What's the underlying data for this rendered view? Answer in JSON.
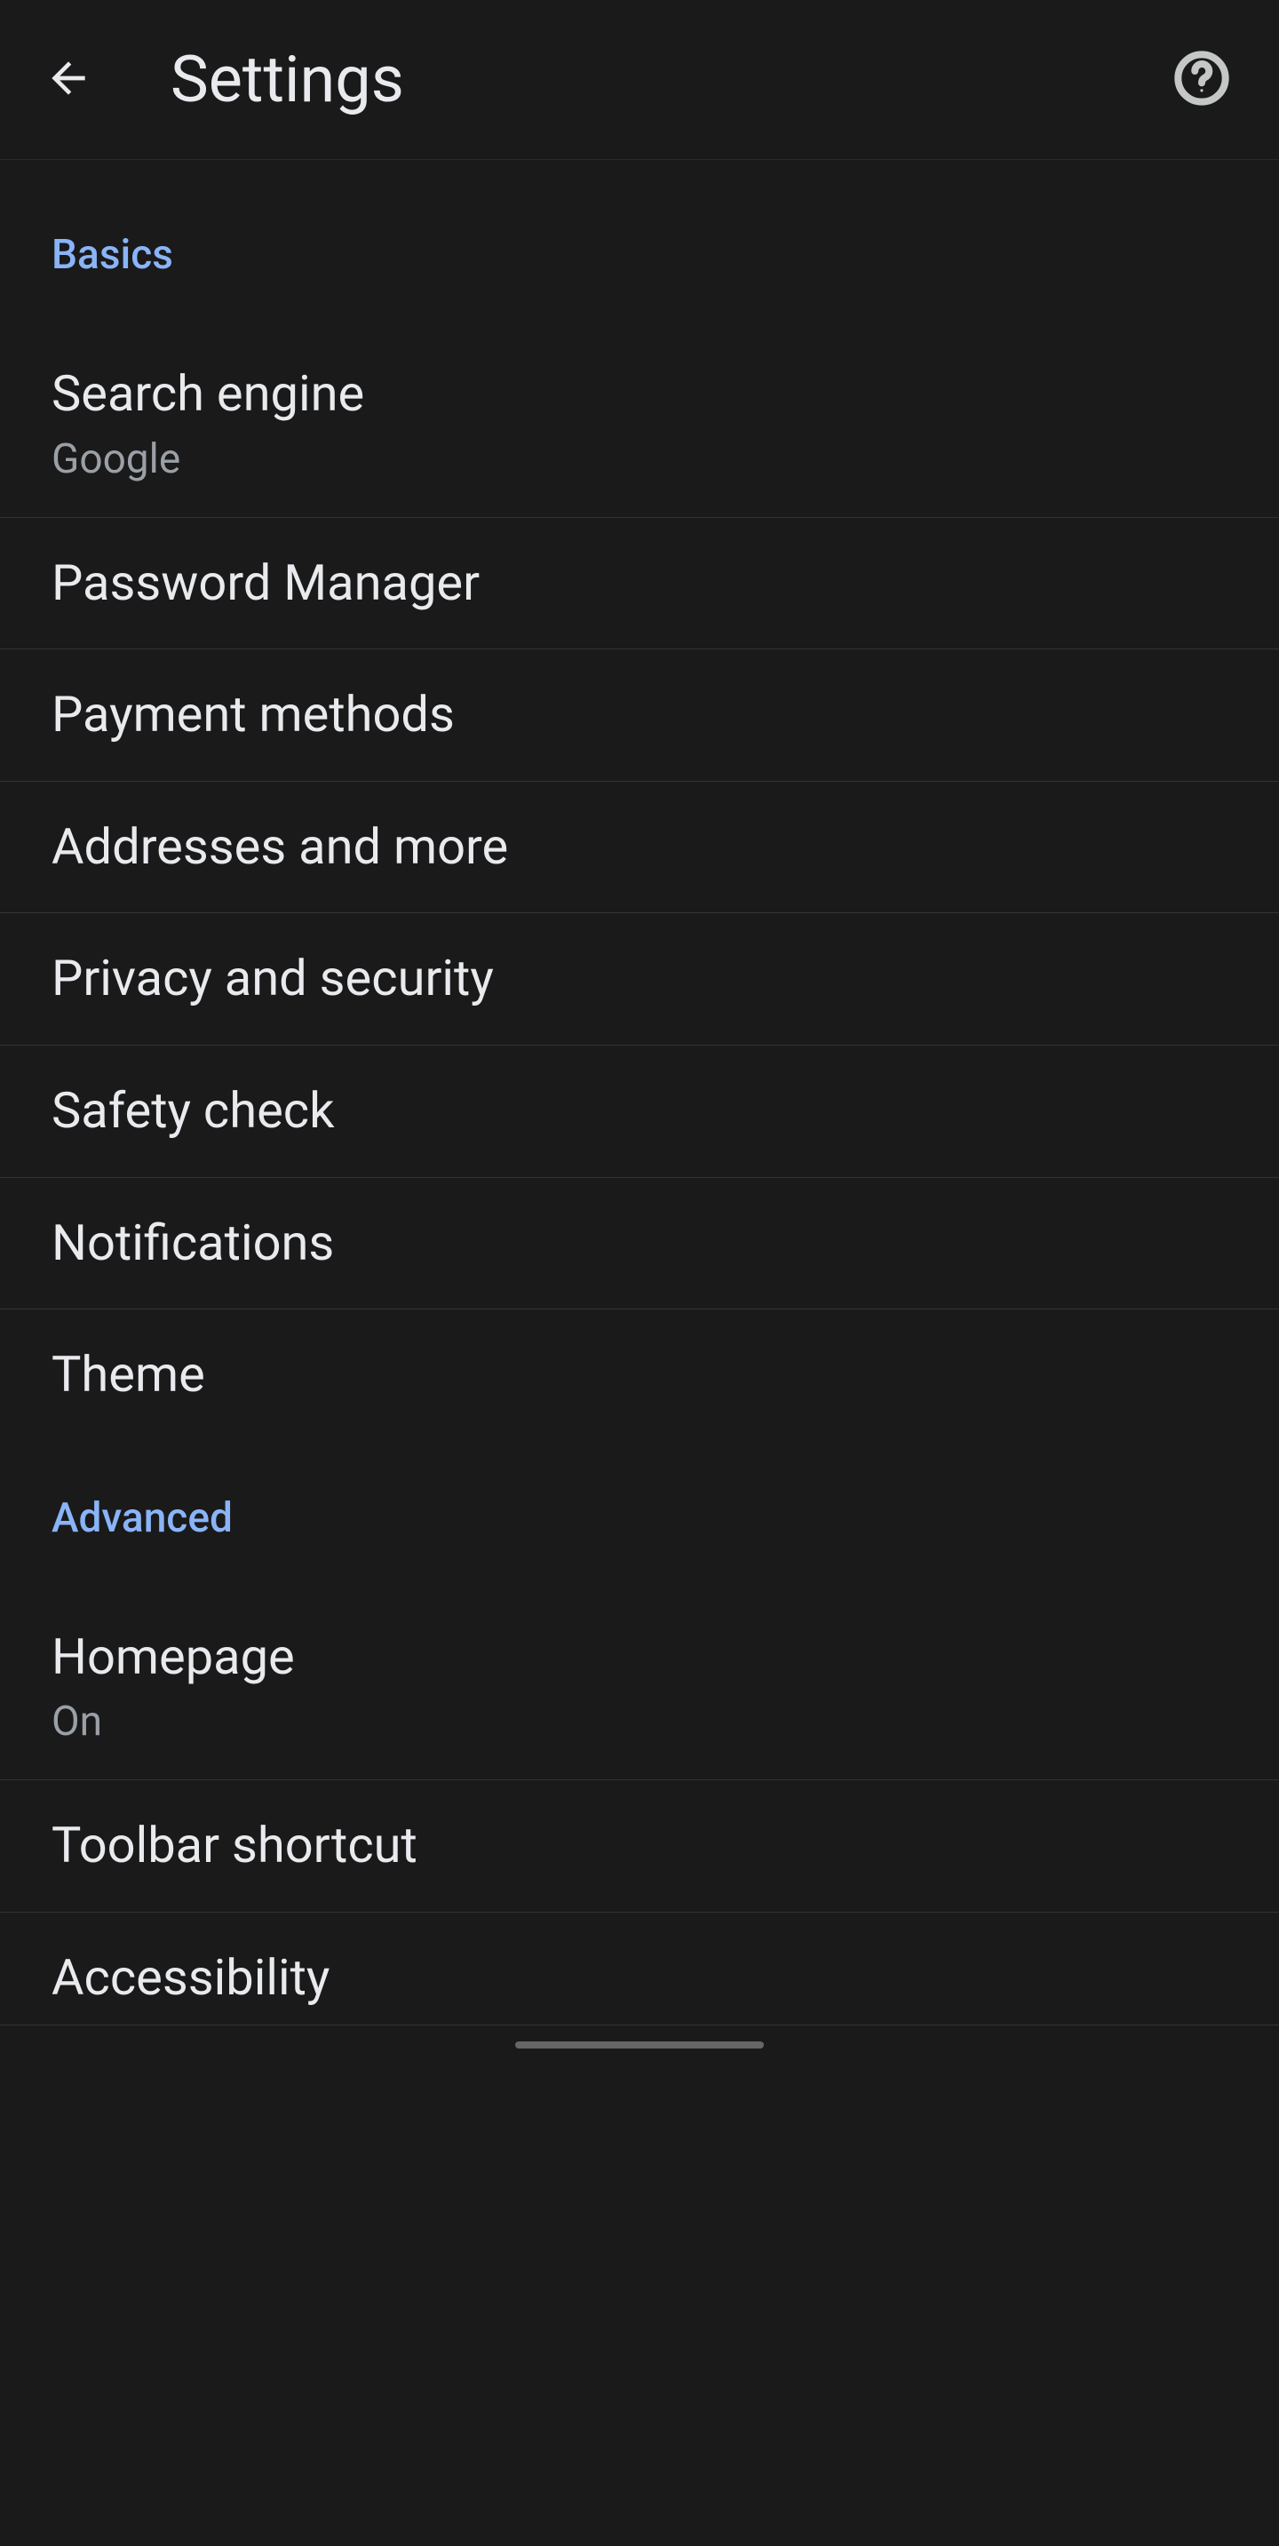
{
  "header": {
    "title": "Settings"
  },
  "sections": [
    {
      "name": "Basics",
      "items": [
        {
          "label": "Search engine",
          "sub": "Google"
        },
        {
          "label": "Password Manager"
        },
        {
          "label": "Payment methods"
        },
        {
          "label": "Addresses and more"
        },
        {
          "label": "Privacy and security"
        },
        {
          "label": "Safety check"
        },
        {
          "label": "Notifications"
        },
        {
          "label": "Theme"
        }
      ]
    },
    {
      "name": "Advanced",
      "items": [
        {
          "label": "Homepage",
          "sub": "On"
        },
        {
          "label": "Toolbar shortcut"
        },
        {
          "label": "Accessibility"
        }
      ]
    }
  ]
}
